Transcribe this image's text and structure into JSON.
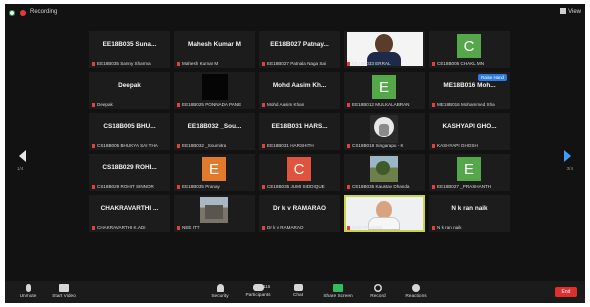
{
  "topbar": {
    "recording_label": "Recording",
    "view_label": "View"
  },
  "tiles": [
    {
      "name": "EE18B035 Suna...",
      "caption": "EE18B035 Sanny Sharma"
    },
    {
      "name": "Mahesh Kumar M",
      "caption": "Mahesh Kumar M"
    },
    {
      "name": "EE18B027 Patnay...",
      "caption": "EE18B027 Patnala Naga Sai"
    },
    {
      "name": "",
      "caption": "EE18B033 ERRAL",
      "photo": "person-logo"
    },
    {
      "name": "",
      "caption": "CE18B005 CHAKL MN",
      "letter": "C",
      "color": "#55a84a"
    },
    {
      "name": "Deepak",
      "caption": "Deepak"
    },
    {
      "name": "",
      "caption": "EE18B025 PONNADA PANE",
      "photo": "dark"
    },
    {
      "name": "Mohd Aasim Kh...",
      "caption": "Mohd Aasim Khan"
    },
    {
      "name": "",
      "caption": "EE18B012 MULKALABRAN",
      "letter": "E",
      "color": "#55a84a"
    },
    {
      "name": "ME18B016 Moh...",
      "caption": "ME18B016 Mohammed Sha",
      "hand": "Raise Hand"
    },
    {
      "name": "CS18B005 BHU...",
      "caption": "CS18B005 BHUKYA SAI THA",
      "muted": true
    },
    {
      "name": "EE18B032 _Sou...",
      "caption": "EE18B032 _Soumitra"
    },
    {
      "name": "EE18B031 HARS...",
      "caption": "EE18B031 HARSHITH"
    },
    {
      "name": "",
      "caption": "CS18B018 Singarapu - K",
      "photo": "anime"
    },
    {
      "name": "KASHYAPI GHO...",
      "caption": "KASHYAPI GHOSH"
    },
    {
      "name": "CS18B029 ROHI...",
      "caption": "CS18B029 ROHIT SINNOR"
    },
    {
      "name": "",
      "caption": "EE18B035 Pranay",
      "letter": "E",
      "color": "#e27a2e"
    },
    {
      "name": "",
      "caption": "CE18B035 JUMI SIDDIQUE",
      "letter": "C",
      "color": "#e0533c"
    },
    {
      "name": "",
      "caption": "CE18B035 Kaustav Dhanda",
      "photo": "landscape"
    },
    {
      "name": "",
      "caption": "EE18B027 _PRASHANTH",
      "letter": "E",
      "color": "#55a84a"
    },
    {
      "name": "CHAKRAVARTHI ...",
      "caption": "CHAKRAVARTHI K.ADI"
    },
    {
      "name": "",
      "caption": "NEE ITT",
      "photo": "city"
    },
    {
      "name": "Dr k v RAMARAO",
      "caption": "Dr k v RAMARAO"
    },
    {
      "name": "",
      "caption": "RAO PRASAD",
      "photo": "man",
      "active": true
    },
    {
      "name": "N k ran naik",
      "caption": "N k ran naik"
    }
  ],
  "nav": {
    "left_page": "1/4",
    "right_page": "3/4"
  },
  "toolbar": {
    "unmute": "Unmute",
    "start_video": "Start Video",
    "security": "Security",
    "participants": "Participants",
    "participants_count": "115",
    "chat": "Chat",
    "share_screen": "Share Screen",
    "record": "Record",
    "reactions": "Reactions",
    "end": "End"
  }
}
